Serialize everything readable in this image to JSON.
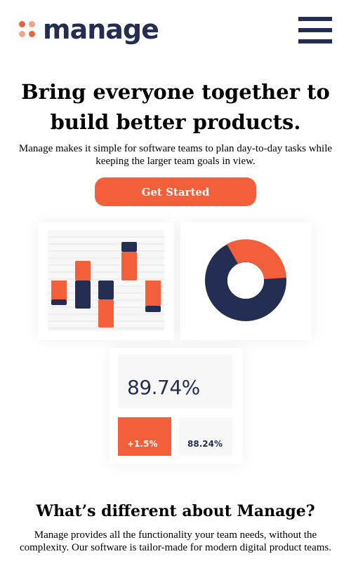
{
  "header": {
    "logo_text": "manage",
    "logo_icon": "four-dots-logo-icon",
    "menu_icon": "hamburger-menu-icon"
  },
  "hero": {
    "title": "Bring everyone together to build better products.",
    "subtitle": "Manage makes it simple for software teams to plan day-to-day tasks while keeping the larger team goals in view.",
    "cta_label": "Get Started"
  },
  "illustration": {
    "stat_main": "89.74%",
    "stat_up": "+1.5%",
    "stat_side": "88.24%",
    "donut_primary_fraction": 0.72,
    "bars": [
      {
        "navy": [
          0.0,
          0.1
        ],
        "orange": [
          0.1,
          0.0
        ],
        "type": "down-navy-bottom"
      },
      {
        "type": "mixed"
      },
      {
        "type": "mixed"
      },
      {
        "type": "mixed"
      },
      {
        "type": "mixed"
      }
    ]
  },
  "section": {
    "title": "What’s different about Manage?",
    "text": "Manage provides all the functionality your team needs, without the complexity. Our software is tailor-made for modern digital product teams."
  },
  "colors": {
    "accent": "#f25f3a",
    "navy": "#242d52",
    "light": "#f7f7f7"
  }
}
